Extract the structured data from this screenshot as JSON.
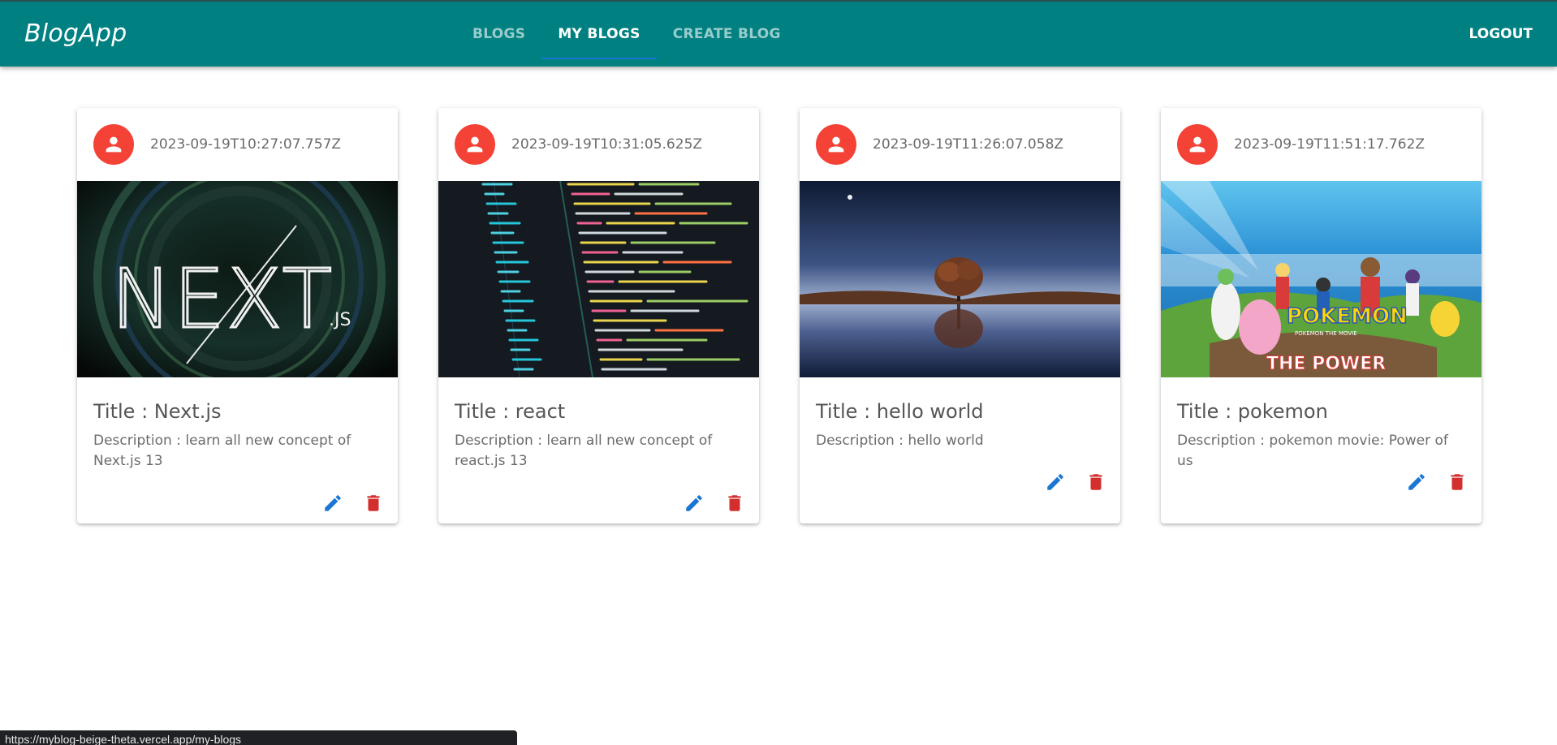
{
  "app": {
    "brand": "BlogApp"
  },
  "nav": {
    "tabs": [
      {
        "label": "Blogs",
        "active": false
      },
      {
        "label": "My Blogs",
        "active": true
      },
      {
        "label": "Create Blog",
        "active": false
      }
    ],
    "logout_label": "Logout"
  },
  "colors": {
    "appbar": "#008080",
    "avatar": "#f44336",
    "edit_icon": "#1976d2",
    "delete_icon": "#d32f2f",
    "tab_indicator": "#1976d2"
  },
  "blogs": [
    {
      "timestamp": "2023-09-19T10:27:07.757Z",
      "title": "Title : Next.js",
      "description": "Description : learn all new concept of Next.js 13",
      "image": "nextjs-banner",
      "image_text": "NEXT",
      "image_subtext": ".JS"
    },
    {
      "timestamp": "2023-09-19T10:31:05.625Z",
      "title": "Title : react",
      "description": "Description : learn all new concept of react.js 13",
      "image": "code-editor-screenshot"
    },
    {
      "timestamp": "2023-09-19T11:26:07.058Z",
      "title": "Title : hello world",
      "description": "Description : hello world",
      "image": "tree-reflection-night"
    },
    {
      "timestamp": "2023-09-19T11:51:17.762Z",
      "title": "Title : pokemon",
      "description": "Description : pokemon movie: Power of us",
      "image": "pokemon-movie-poster",
      "image_text": "POKEMON",
      "image_subtext": "POKEMON THE MOVIE",
      "image_caption": "THE POWER"
    }
  ],
  "icons": {
    "avatar": "person-icon",
    "edit": "pencil-icon",
    "delete": "trash-icon"
  },
  "status_url": "https://myblog-beige-theta.vercel.app/my-blogs"
}
